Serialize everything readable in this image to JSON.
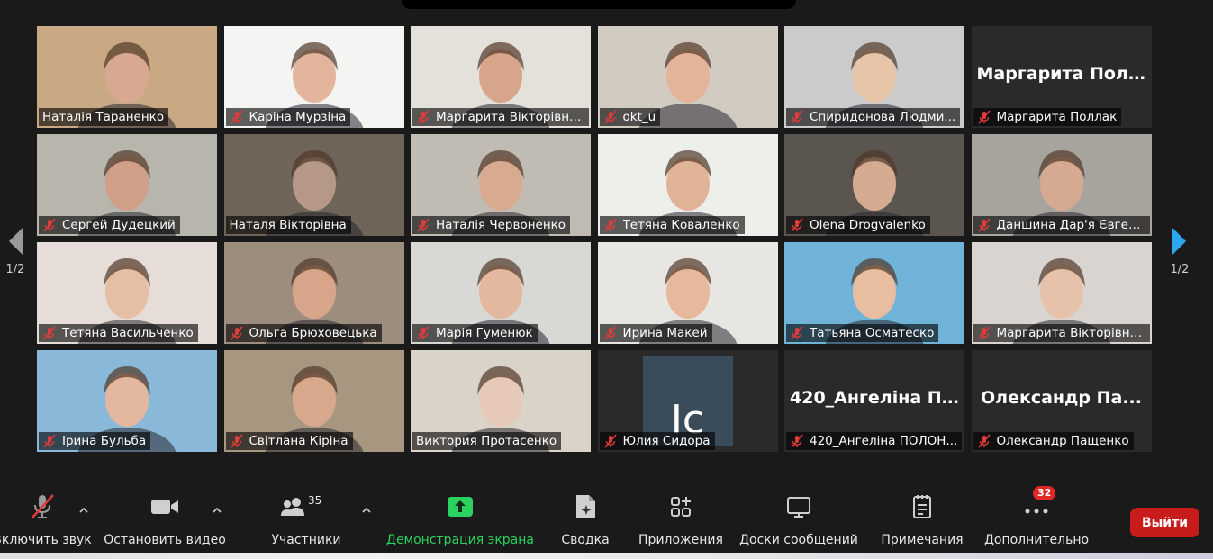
{
  "pager": {
    "left_page": "1/2",
    "right_page": "1/2"
  },
  "participants": [
    {
      "name": "Наталія Тараненко",
      "muted": false,
      "active": true,
      "bg": "#c9a884",
      "skin": "#d9a890"
    },
    {
      "name": "Каріна Мурзіна",
      "muted": true,
      "bg": "#f4f4f2",
      "skin": "#e2b59c"
    },
    {
      "name": "Маргарита Вікторівна...",
      "muted": true,
      "bg": "#e4e1da",
      "skin": "#d6a58a"
    },
    {
      "name": "okt_u",
      "muted": true,
      "bg": "#d2cbc2",
      "skin": "#e4b49a"
    },
    {
      "name": "Спиридонова Людми...",
      "muted": true,
      "bg": "#cbcbcb",
      "skin": "#e7c5a9"
    },
    {
      "name": "Маргарита Поллак",
      "muted": true,
      "big_label": "Маргарита  Пол..."
    },
    {
      "name": "Сергей Дудецкий",
      "muted": true,
      "bg": "#b8b5ad",
      "skin": "#cf9f88"
    },
    {
      "name": "Наталя Вікторівна",
      "muted": false,
      "bg": "#6e6458",
      "skin": "#b59888"
    },
    {
      "name": "Наталія Червоненко",
      "muted": true,
      "bg": "#c0bcb4",
      "skin": "#d8ab90"
    },
    {
      "name": "Тетяна Коваленко",
      "muted": true,
      "bg": "#eeeeea",
      "skin": "#e1b397"
    },
    {
      "name": "Olena Drogvalenko",
      "muted": true,
      "bg": "#5b5550",
      "skin": "#d4aa90"
    },
    {
      "name": "Даншина Дар'я Євген...",
      "muted": true,
      "bg": "#a7a39d",
      "skin": "#d6aa92"
    },
    {
      "name": "Тетяна Васильченко",
      "muted": true,
      "bg": "#e7ddd8",
      "skin": "#e6bea6"
    },
    {
      "name": "Ольга Брюховецька",
      "muted": true,
      "bg": "#9c8d7f",
      "skin": "#d9a58a"
    },
    {
      "name": "Марія Гуменюк",
      "muted": true,
      "bg": "#d8d8d4",
      "skin": "#e4b79f"
    },
    {
      "name": "Ирина Макей",
      "muted": true,
      "bg": "#e8e6e2",
      "skin": "#e6b89c"
    },
    {
      "name": "Татьяна Осматеско",
      "muted": true,
      "bg": "#6fb4d8",
      "skin": "#e9bda0"
    },
    {
      "name": "Маргарита Вікторівна...",
      "muted": true,
      "bg": "#d9d4cf",
      "skin": "#e7c2aa"
    },
    {
      "name": "Ірина Бульба",
      "muted": true,
      "bg": "#8ab8d8",
      "skin": "#e3b89e"
    },
    {
      "name": "Світлана Кіріна",
      "muted": true,
      "bg": "#a79780",
      "skin": "#d9a98e"
    },
    {
      "name": "Виктория    Протасенко",
      "muted": false,
      "bg": "#d9d3c8",
      "skin": "#e6c9b8"
    },
    {
      "name": "Юлия Сидора",
      "muted": true,
      "logo": "#3a4b5a",
      "logo_text": "Ic"
    },
    {
      "name": "420_Ангеліна ПОЛОН...",
      "muted": true,
      "big_label": "420_Ангеліна П..."
    },
    {
      "name": "Олександр Пащенко",
      "muted": true,
      "big_label": "Олександр  Па..."
    }
  ],
  "toolbar": {
    "unmute": "Включить звук",
    "stop_video": "Остановить видео",
    "participants": "Участники",
    "participants_count": "35",
    "share": "Демонстрация экрана",
    "summary": "Сводка",
    "apps": "Приложения",
    "boards": "Доски сообщений",
    "notes": "Примечания",
    "more": "Дополнительно",
    "more_badge": "32",
    "leave": "Выйти"
  },
  "colors": {
    "share_green": "#2bd25f",
    "leave_red": "#c81c1c",
    "active_border": "#d6e27a",
    "mute_red": "#e23b3b"
  }
}
